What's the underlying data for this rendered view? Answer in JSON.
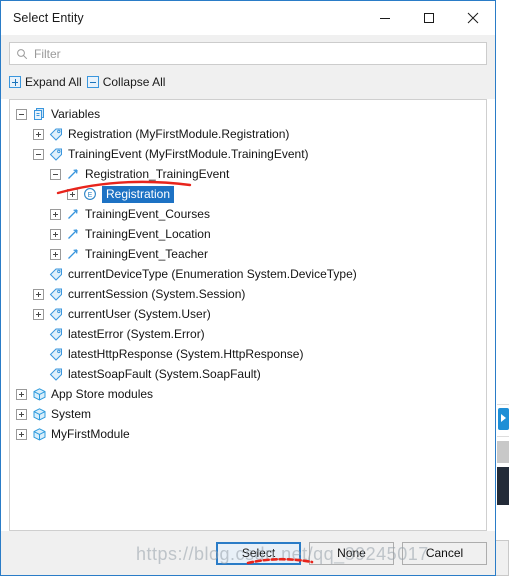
{
  "window": {
    "title": "Select Entity",
    "controls": [
      {
        "name": "minimize",
        "glyph": "minimize-icon"
      },
      {
        "name": "maximize",
        "glyph": "maximize-icon"
      },
      {
        "name": "close",
        "glyph": "close-icon"
      }
    ]
  },
  "search": {
    "placeholder": "Filter",
    "value": "",
    "icon": "search-icon"
  },
  "toolbar": {
    "expand_all_label": "Expand All",
    "collapse_all_label": "Collapse All"
  },
  "tree": {
    "items": [
      {
        "label": "Variables",
        "indent": 0,
        "twisty": "minus",
        "icon": "variables-icon",
        "selected": false
      },
      {
        "label": "Registration (MyFirstModule.Registration)",
        "indent": 1,
        "twisty": "plus",
        "icon": "tag-icon",
        "selected": false
      },
      {
        "label": "TrainingEvent (MyFirstModule.TrainingEvent)",
        "indent": 1,
        "twisty": "minus",
        "icon": "tag-icon",
        "selected": false
      },
      {
        "label": "Registration_TrainingEvent",
        "indent": 2,
        "twisty": "minus",
        "icon": "association-icon",
        "selected": false
      },
      {
        "label": "Registration",
        "indent": 3,
        "twisty": "plus",
        "icon": "entity-icon",
        "selected": true
      },
      {
        "label": "TrainingEvent_Courses",
        "indent": 2,
        "twisty": "plus",
        "icon": "association-icon",
        "selected": false
      },
      {
        "label": "TrainingEvent_Location",
        "indent": 2,
        "twisty": "plus",
        "icon": "association-icon",
        "selected": false
      },
      {
        "label": "TrainingEvent_Teacher",
        "indent": 2,
        "twisty": "plus",
        "icon": "association-icon",
        "selected": false
      },
      {
        "label": "currentDeviceType (Enumeration System.DeviceType)",
        "indent": 1,
        "twisty": "none",
        "icon": "tag-icon",
        "selected": false
      },
      {
        "label": "currentSession (System.Session)",
        "indent": 1,
        "twisty": "plus",
        "icon": "tag-icon",
        "selected": false
      },
      {
        "label": "currentUser (System.User)",
        "indent": 1,
        "twisty": "plus",
        "icon": "tag-icon",
        "selected": false
      },
      {
        "label": "latestError (System.Error)",
        "indent": 1,
        "twisty": "none",
        "icon": "tag-icon",
        "selected": false
      },
      {
        "label": "latestHttpResponse (System.HttpResponse)",
        "indent": 1,
        "twisty": "none",
        "icon": "tag-icon",
        "selected": false
      },
      {
        "label": "latestSoapFault (System.SoapFault)",
        "indent": 1,
        "twisty": "none",
        "icon": "tag-icon",
        "selected": false
      },
      {
        "label": "App Store modules",
        "indent": 0,
        "twisty": "plus",
        "icon": "module-icon",
        "selected": false
      },
      {
        "label": "System",
        "indent": 0,
        "twisty": "plus",
        "icon": "module-icon",
        "selected": false
      },
      {
        "label": "MyFirstModule",
        "indent": 0,
        "twisty": "plus",
        "icon": "module-icon",
        "selected": false
      }
    ]
  },
  "buttons": {
    "select_label": "Select",
    "none_label": "None",
    "cancel_label": "Cancel"
  },
  "watermark": {
    "text": "https://blog.csdn.net/qq_39245017"
  },
  "colors": {
    "accent": "#2a7cc7",
    "selection": "#1d72c4",
    "annotation": "#e8241c",
    "icon_blue": "#3a96dd",
    "panel": "#f0f0f0"
  }
}
